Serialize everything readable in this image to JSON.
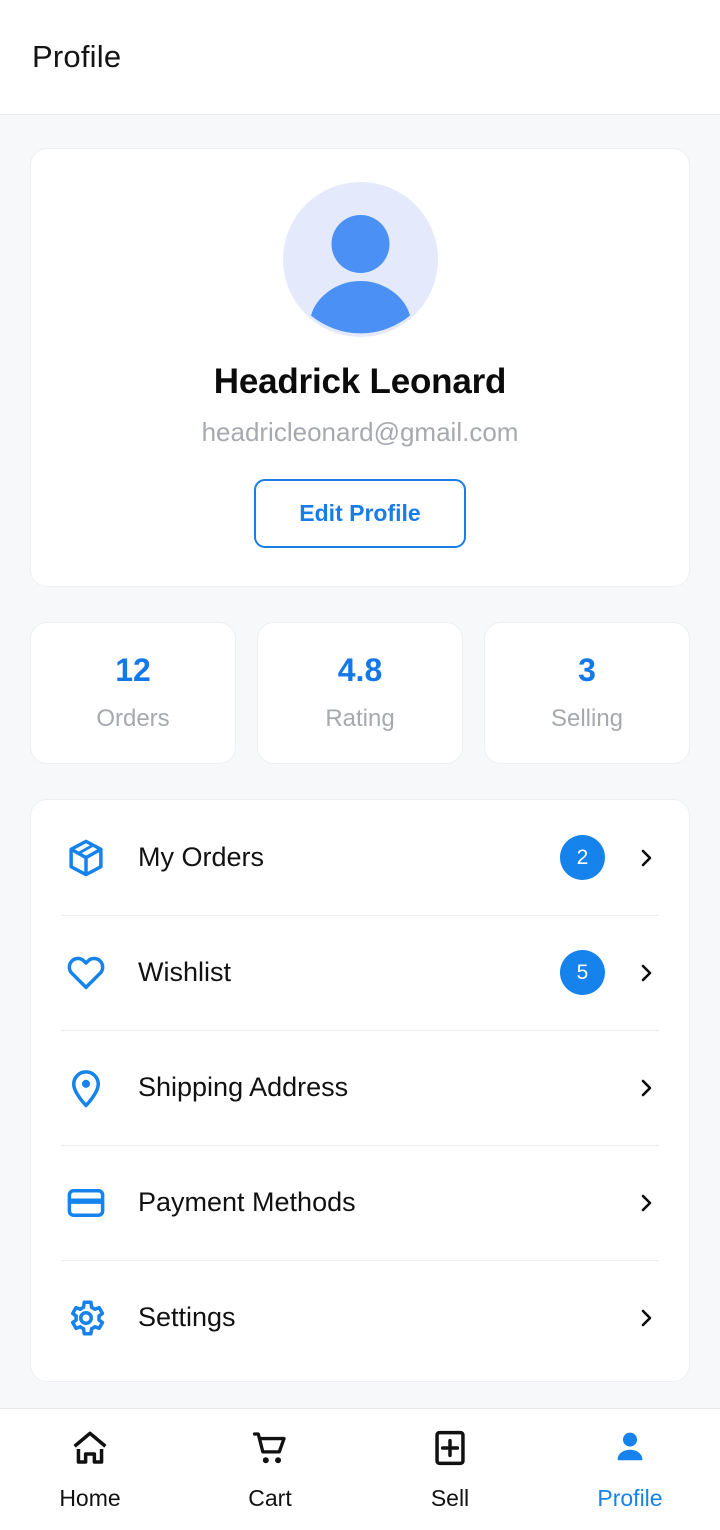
{
  "header": {
    "title": "Profile"
  },
  "profile": {
    "avatar_icon": "person-avatar-icon",
    "name": "Headrick Leonard",
    "email": "headricleonard@gmail.com",
    "edit_button_label": "Edit Profile"
  },
  "stats": [
    {
      "value": "12",
      "label": "Orders"
    },
    {
      "value": "4.8",
      "label": "Rating"
    },
    {
      "value": "3",
      "label": "Selling"
    }
  ],
  "menu": [
    {
      "icon": "package-box-icon",
      "label": "My Orders",
      "badge": "2"
    },
    {
      "icon": "heart-icon",
      "label": "Wishlist",
      "badge": "5"
    },
    {
      "icon": "map-pin-icon",
      "label": "Shipping Address",
      "badge": ""
    },
    {
      "icon": "credit-card-icon",
      "label": "Payment Methods",
      "badge": ""
    },
    {
      "icon": "gear-icon",
      "label": "Settings",
      "badge": ""
    }
  ],
  "bottom_nav": [
    {
      "icon": "home-icon",
      "label": "Home",
      "active": false
    },
    {
      "icon": "cart-icon",
      "label": "Cart",
      "active": false
    },
    {
      "icon": "sell-plus-icon",
      "label": "Sell",
      "active": false
    },
    {
      "icon": "person-icon",
      "label": "Profile",
      "active": true
    }
  ],
  "colors": {
    "accent": "#1583eb",
    "accent_dark": "#1a7ce8",
    "page_bg": "#f6f8fa",
    "card_bg": "#ffffff",
    "border": "#edeff2",
    "muted_text": "#a6a9ae",
    "avatar_bg": "#e4eafc"
  }
}
